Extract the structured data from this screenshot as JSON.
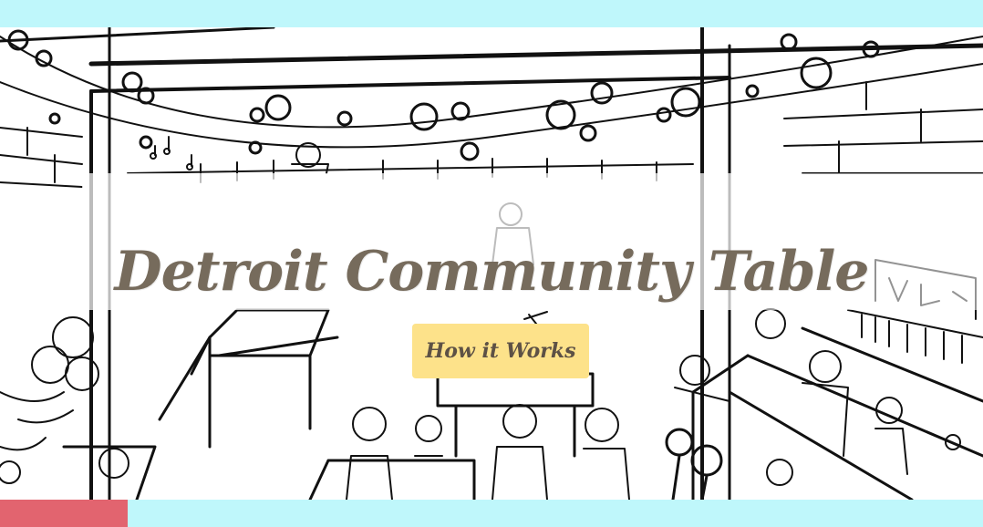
{
  "hero": {
    "title": "Detroit Community Table",
    "cta_label": "How it Works",
    "illustration": "backyard-party-sketch"
  },
  "colors": {
    "frame": "#bff7fb",
    "accent": "#e2646f",
    "title_text": "#766b5c",
    "cta_background": "#fde28a",
    "cta_text": "#5d5145"
  }
}
